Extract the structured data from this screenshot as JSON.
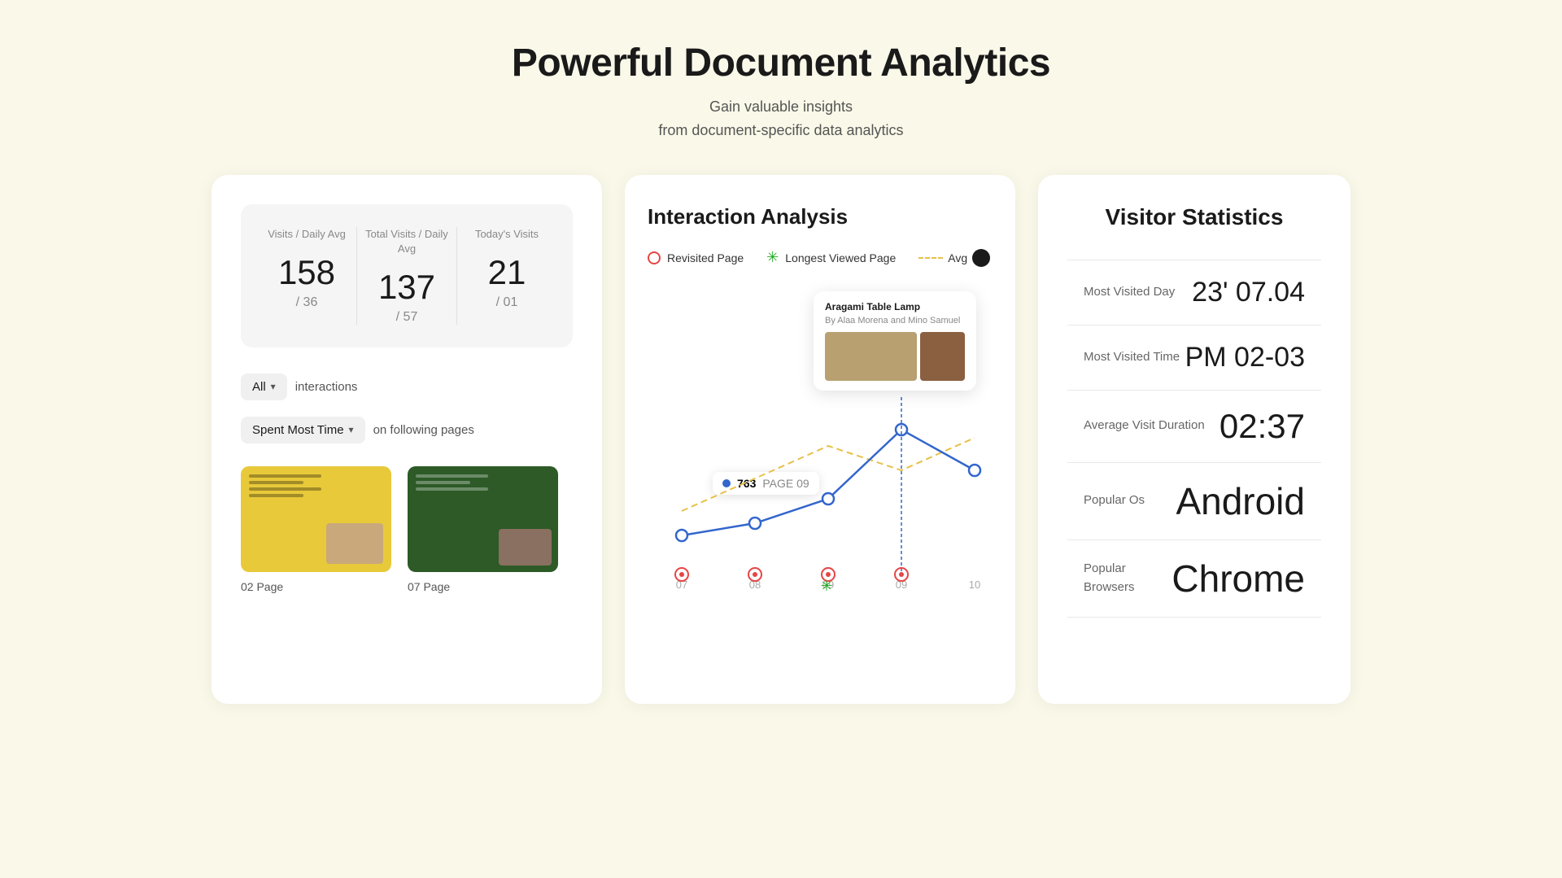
{
  "header": {
    "title": "Powerful Document Analytics",
    "subtitle_line1": "Gain valuable insights",
    "subtitle_line2": "from document-specific data analytics"
  },
  "left_card": {
    "stats": [
      {
        "label": "Visits / Daily Avg",
        "value": "158",
        "sub": "/ 36"
      },
      {
        "label": "Total Visits / Daily Avg",
        "value": "137",
        "sub": "/ 57"
      },
      {
        "label": "Today's Visits",
        "value": "21",
        "sub": "/ 01"
      }
    ],
    "filter1_value": "All",
    "filter1_label": "interactions",
    "filter2_value": "Spent Most Time",
    "filter2_label": "on following pages",
    "pages": [
      {
        "label": "02 Page",
        "color": "yellow"
      },
      {
        "label": "07 Page",
        "color": "green"
      }
    ]
  },
  "middle_card": {
    "title": "Interaction Analysis",
    "legend": {
      "revisit_label": "Revisited Page",
      "longest_label": "Longest Viewed Page",
      "avg_label": "Avg"
    },
    "popup": {
      "title": "Aragami Table Lamp",
      "sub": "By Alaa Morena and Mino Samuel"
    },
    "bubble": {
      "value": "763",
      "page": "PAGE 09"
    },
    "x_labels": [
      "07",
      "08",
      "09",
      "10"
    ]
  },
  "right_card": {
    "title": "Visitor Statistics",
    "stats": [
      {
        "label": "Most\nVisited Day",
        "value": "23' 07.04"
      },
      {
        "label": "Most\nVisited Time",
        "value": "PM 02-03"
      },
      {
        "label": "Average\nVisit Duration",
        "value": "02:37"
      },
      {
        "label": "Popular Os",
        "value": "Android"
      },
      {
        "label": "Popular Browsers",
        "value": "Chrome"
      }
    ]
  }
}
